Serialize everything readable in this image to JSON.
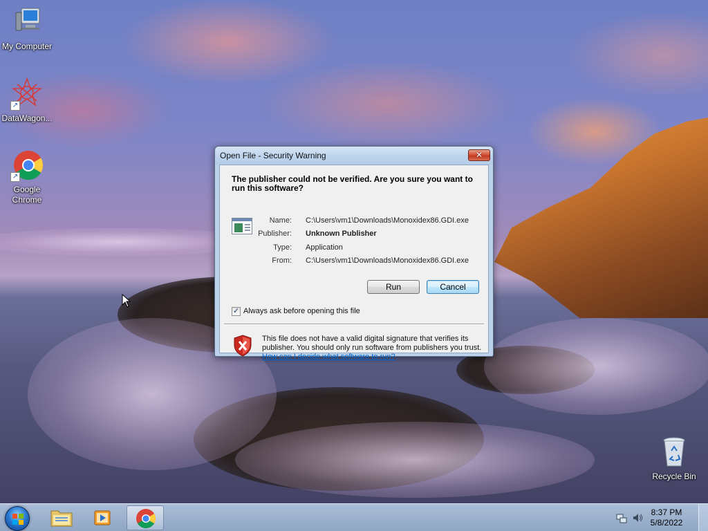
{
  "desktop": {
    "icons": [
      {
        "label": "My Computer"
      },
      {
        "label": "DataWagon..."
      },
      {
        "label": "Google Chrome"
      },
      {
        "label": "Recycle Bin"
      }
    ]
  },
  "dialog": {
    "title": "Open File - Security Warning",
    "close_glyph": "✕",
    "headline": "The publisher could not be verified.  Are you sure you want to run this software?",
    "details": [
      {
        "label": "Name:",
        "value": "C:\\Users\\vm1\\Downloads\\Monoxidex86.GDI.exe",
        "bold": false
      },
      {
        "label": "Publisher:",
        "value": "Unknown Publisher",
        "bold": true
      },
      {
        "label": "Type:",
        "value": "Application",
        "bold": false
      },
      {
        "label": "From:",
        "value": "C:\\Users\\vm1\\Downloads\\Monoxidex86.GDI.exe",
        "bold": false
      }
    ],
    "run_label": "Run",
    "cancel_label": "Cancel",
    "checkbox_label": "Always ask before opening this file",
    "checkbox_checked": true,
    "checkbox_mark": "✓",
    "warning_text": "This file does not have a valid digital signature that verifies its publisher.  You should only run software from publishers you trust.",
    "warning_link": "How can I decide what software to run?"
  },
  "taskbar": {
    "items": [
      "windows-explorer",
      "media-player",
      "google-chrome"
    ],
    "active_item": "google-chrome",
    "clock_time": "8:37 PM",
    "clock_date": "5/8/2022"
  },
  "colors": {
    "link": "#0066cc",
    "close_button": "#c33a20",
    "dialog_frame": "#bcd2ea"
  }
}
